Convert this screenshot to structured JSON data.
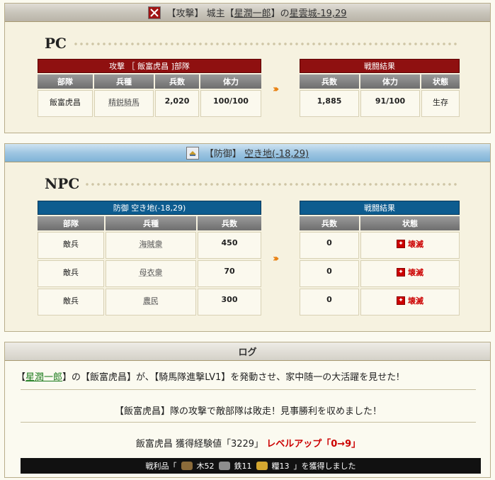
{
  "attack_section": {
    "header_prefix": "【攻撃】 城主【",
    "lord": "星潤一郎",
    "header_mid": "】の",
    "castle": "星雲城-19,29",
    "side_label": "PC",
    "table_title": "攻撃 ［ 飯富虎昌 ]部隊",
    "result_title": "戦闘結果",
    "columns": [
      "部隊",
      "兵種",
      "兵数",
      "体力"
    ],
    "result_columns": [
      "兵数",
      "体力",
      "状態"
    ],
    "row": {
      "unit": "飯富虎昌",
      "type": "精鋭騎馬",
      "troops": "2,020",
      "hp": "100/100"
    },
    "result_row": {
      "troops": "1,885",
      "hp": "91/100",
      "status": "生存"
    }
  },
  "defense_section": {
    "header_prefix": "【防御】",
    "location": "空き地(-18,29)",
    "side_label": "NPC",
    "table_title": "防御  空き地(-18,29)",
    "result_title": "戦闘結果",
    "columns": [
      "部隊",
      "兵種",
      "兵数"
    ],
    "result_columns": [
      "兵数",
      "状態"
    ],
    "rows": [
      {
        "unit": "敵兵",
        "type": "海賊衆",
        "troops": "450",
        "result": "0",
        "status": "壊滅"
      },
      {
        "unit": "敵兵",
        "type": "母衣衆",
        "troops": "70",
        "result": "0",
        "status": "壊滅"
      },
      {
        "unit": "敵兵",
        "type": "農民",
        "troops": "300",
        "result": "0",
        "status": "壊滅"
      }
    ]
  },
  "log_section": {
    "title": "ログ",
    "line1_pre": "【",
    "line1_lord": "星潤一郎",
    "line1_rest": "】の【飯富虎昌】が、【騎馬隊進撃LV1】を発動させ、家中随一の大活躍を見せた!",
    "line2": "【飯富虎昌】隊の攻撃で敵部隊は敗走！見事勝利を収めました！",
    "line3_main": "飯富虎昌 獲得経験値「3229」",
    "line3_levelup": "レベルアップ「0→9」",
    "spoils_prefix": "戦利品「",
    "spoils_wood": "木52",
    "spoils_iron": "鉄11",
    "spoils_rice": "糧13",
    "spoils_suffix": "」を獲得しました"
  },
  "colors": {
    "attack_bar": "#8f1010",
    "defense_bar": "#0d5c8f",
    "destroyed": "#cc0000",
    "arrow": "#e87f10"
  },
  "icons": [
    "sword-icon",
    "shield-icon",
    "orange-arrow-icon",
    "destroyed-icon",
    "wood-icon",
    "iron-icon",
    "rice-icon"
  ]
}
